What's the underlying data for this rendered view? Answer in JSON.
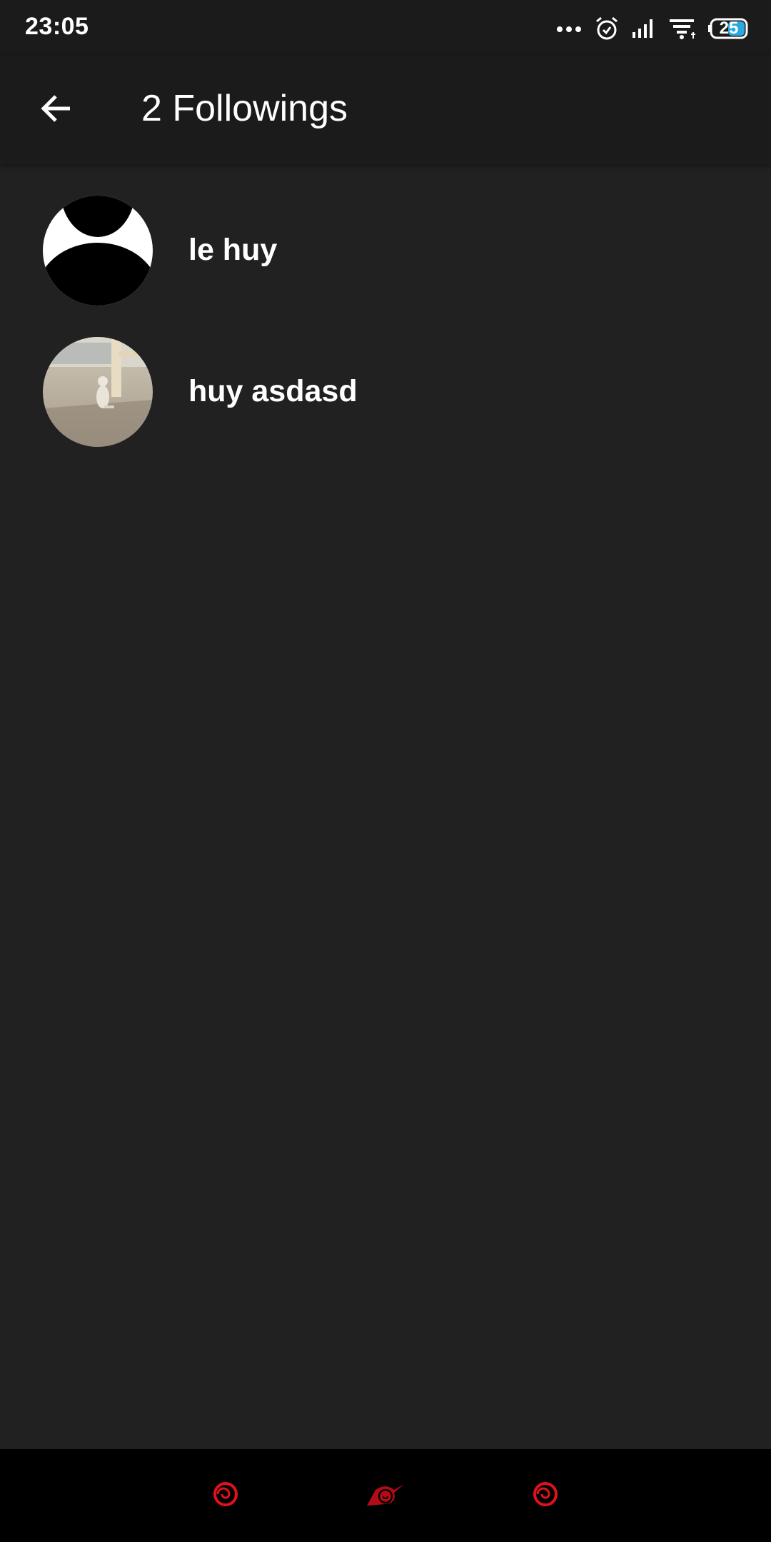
{
  "status_bar": {
    "time": "23:05",
    "battery_level": "25",
    "icons": [
      "more-dots-icon",
      "alarm-icon",
      "signal-icon",
      "wifi-icon",
      "battery-icon"
    ]
  },
  "app_bar": {
    "title": "2 Followings",
    "back_icon": "arrow-back-icon"
  },
  "followings": [
    {
      "name": "le huy",
      "avatar": "default-avatar"
    },
    {
      "name": "huy asdasd",
      "avatar": "cat-photo-avatar"
    }
  ],
  "bottom_nav": {
    "icons": [
      "back-spiral-icon",
      "home-leaf-symbol-icon",
      "recent-spiral-icon"
    ],
    "accent_color": "#e0111e"
  },
  "colors": {
    "background": "#212121",
    "bar_background": "#1b1b1b",
    "text": "#ffffff"
  }
}
